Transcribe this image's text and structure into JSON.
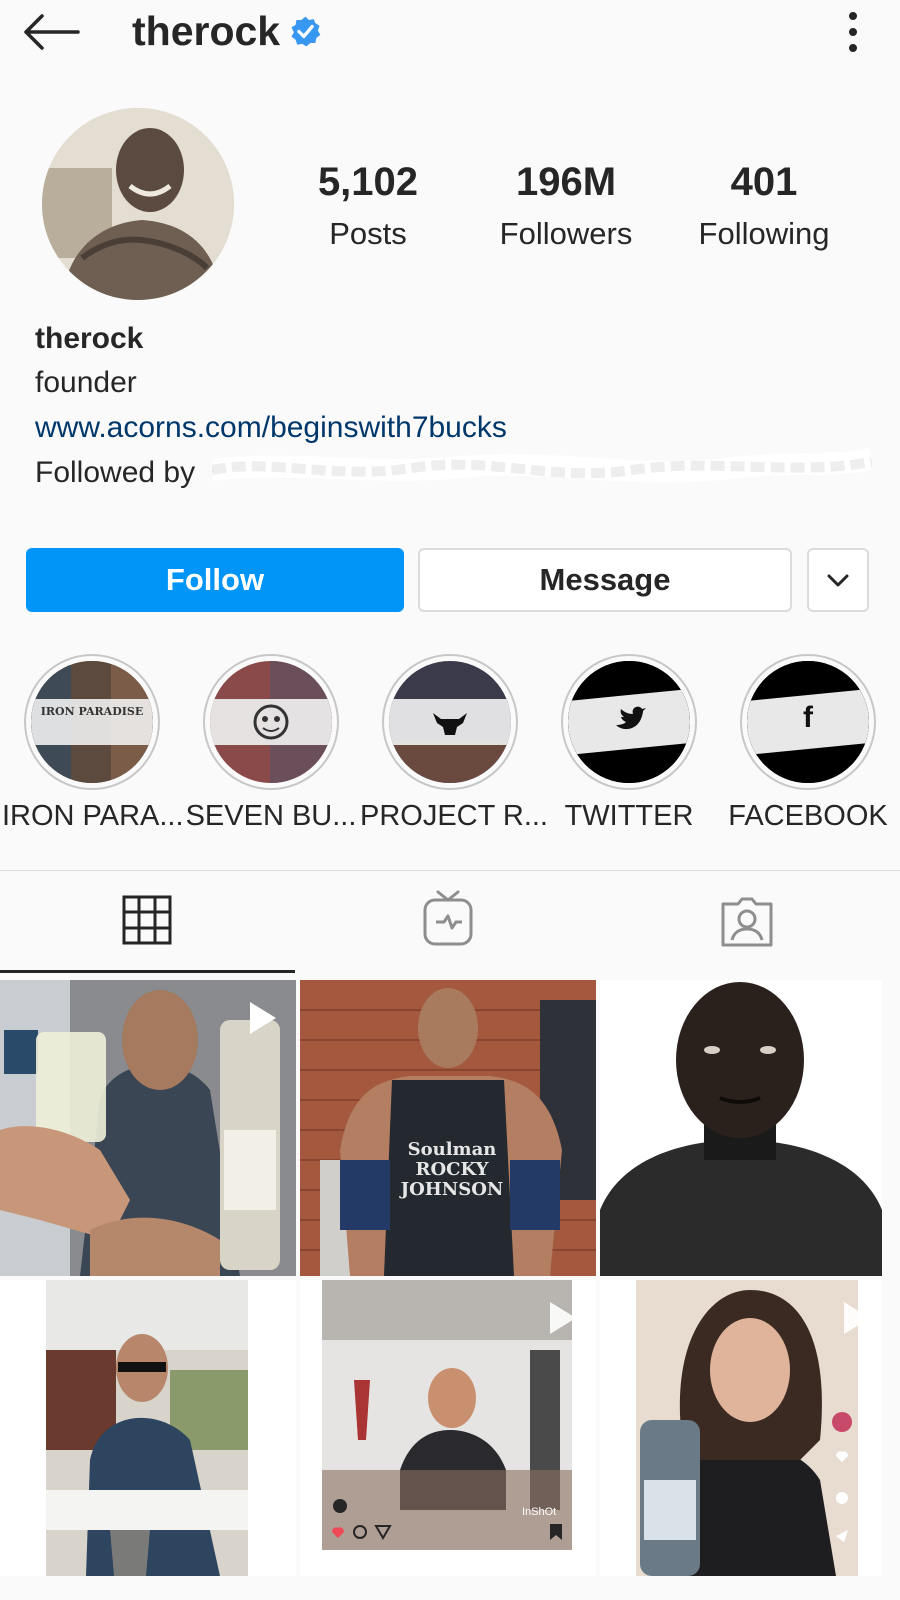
{
  "header": {
    "username": "therock",
    "verified": true
  },
  "stats": [
    {
      "value": "5,102",
      "label": "Posts"
    },
    {
      "value": "196M",
      "label": "Followers"
    },
    {
      "value": "401",
      "label": "Following"
    }
  ],
  "bio": {
    "name": "therock",
    "role": "founder",
    "link": "www.acorns.com/beginswith7bucks",
    "followed_by_prefix": "Followed by"
  },
  "actions": {
    "follow": "Follow",
    "message": "Message"
  },
  "highlights": [
    {
      "label": "IRON PARA...",
      "badge": "IRON PARADISE"
    },
    {
      "label": "SEVEN BU..."
    },
    {
      "label": "PROJECT R..."
    },
    {
      "label": "TWITTER"
    },
    {
      "label": "FACEBOOK",
      "glyph": "f"
    }
  ],
  "posts": [
    {
      "shirt_text": "Soulman ROCKY JOHNSON"
    },
    {
      "watermark": "InShOt"
    }
  ],
  "colors": {
    "accent": "#0095f6",
    "verified": "#3897f0",
    "link": "#00376b"
  }
}
